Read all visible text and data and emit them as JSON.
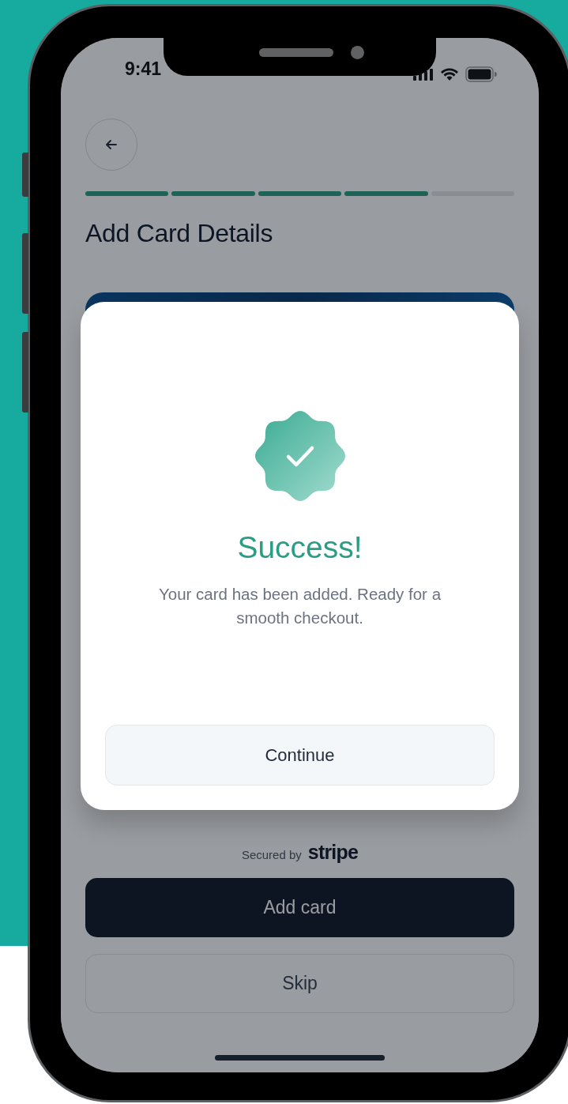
{
  "status_bar": {
    "time": "9:41"
  },
  "header": {
    "title": "Add Card Details"
  },
  "progress": {
    "steps": [
      {
        "completed": true
      },
      {
        "completed": true
      },
      {
        "completed": true
      },
      {
        "completed": true
      },
      {
        "completed": false
      }
    ]
  },
  "footer": {
    "secured_by": "Secured by",
    "brand": "stripe"
  },
  "buttons": [
    {
      "label": "Add card",
      "kind": "primary"
    },
    {
      "label": "Skip",
      "kind": "outline"
    }
  ],
  "dialog": {
    "title": "Success!",
    "message": "Your card has been added. Ready for a smooth checkout.",
    "button": "Continue"
  }
}
